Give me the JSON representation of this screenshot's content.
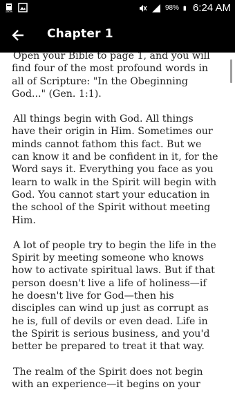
{
  "status_bar": {
    "left_icons": [
      "storage-icon",
      "image-icon"
    ],
    "battery": "98%",
    "time": "6:24 AM",
    "right_icons": [
      "mute-icon",
      "signal-icon",
      "battery-icon"
    ]
  },
  "app_bar": {
    "title": "Chapter 1",
    "back_icon": "arrow-back-icon"
  },
  "paragraphs": [
    "Open your Bible to page 1, and you will find four of the most profound words in all of Scripture: \"In the Obeginning God...\" (Gen. 1:1).",
    "All things begin with God. All things have their origin in Him. Sometimes our minds cannot fathom this fact. But we can know it and be confident in it, for the Word says it. Everything you face as you learn to walk in the Spirit will begin with God. You cannot start your education in the school of the Spirit without meeting Him.",
    "A lot of people try to begin the life in the Spirit by meeting someone who knows how to activate spiritual laws. But if that person doesn't live a life of holiness—if he doesn't live for God—then his disciples can wind up just as corrupt as he is, full of devils or even dead. Life in the Spirit is serious business, and you'd better be prepared to treat it that way.",
    "The realm of the Spirit does not begin with an experience—it begins on your"
  ]
}
